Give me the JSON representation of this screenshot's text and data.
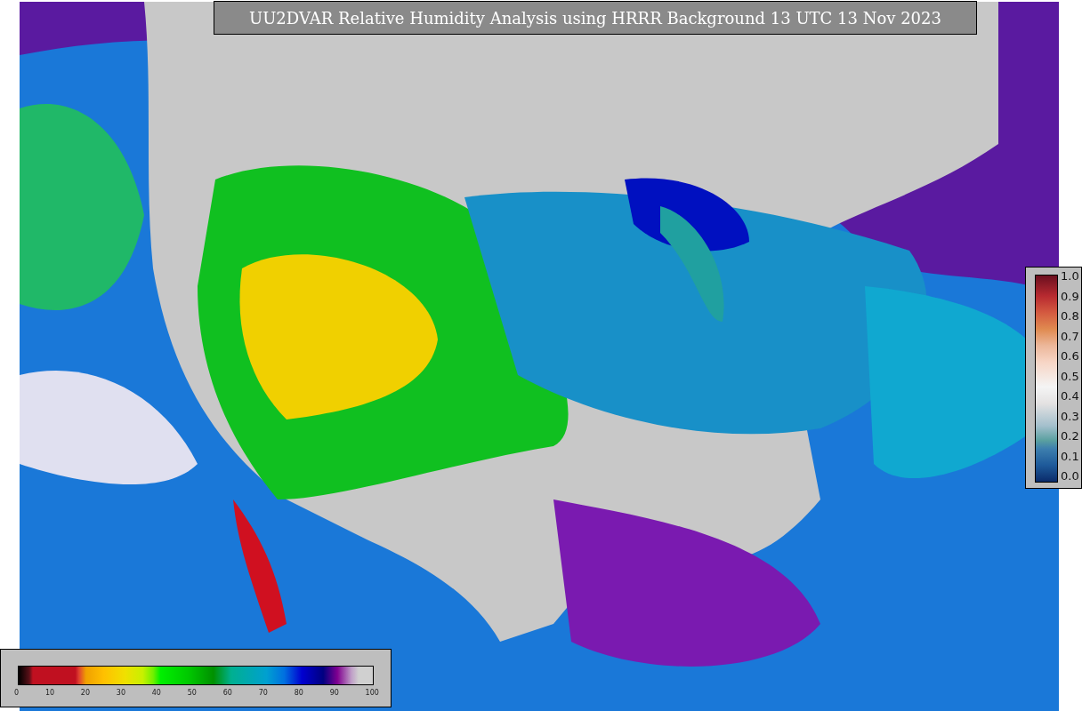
{
  "title": "UU2DVAR Relative Humidity Analysis using HRRR Background 13 UTC 13 Nov 2023",
  "observation_colorbar": {
    "ticks": [
      "1.0",
      "0.9",
      "0.8",
      "0.7",
      "0.6",
      "0.5",
      "0.4",
      "0.3",
      "0.2",
      "0.1",
      "0.0"
    ]
  },
  "humidity_colorbar": {
    "ticks": [
      "0",
      "10",
      "20",
      "30",
      "40",
      "50",
      "60",
      "70",
      "80",
      "90",
      "100"
    ]
  }
}
